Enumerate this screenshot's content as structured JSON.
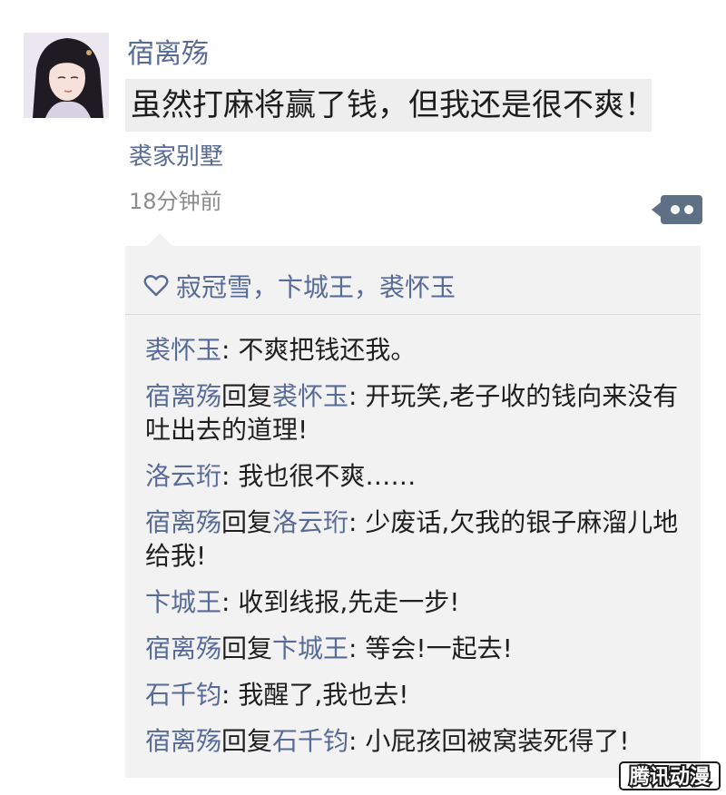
{
  "post": {
    "author": "宿离殇",
    "text": "虽然打麻将赢了钱，但我还是很不爽！",
    "location": "裘家别墅",
    "time": "18分钟前"
  },
  "likes": {
    "names": "寂冠雪，卞城王，裘怀玉"
  },
  "comments": [
    {
      "from": "裘怀玉",
      "reply_word": "",
      "to": "",
      "text": ": 不爽把钱还我。"
    },
    {
      "from": "宿离殇",
      "reply_word": "回复",
      "to": "裘怀玉",
      "text": ": 开玩笑,老子收的钱向来没有吐出去的道理!"
    },
    {
      "from": "洛云珩",
      "reply_word": "",
      "to": "",
      "text": ": 我也很不爽……"
    },
    {
      "from": "宿离殇",
      "reply_word": "回复",
      "to": "洛云珩",
      "text": ": 少废话,欠我的银子麻溜儿地给我!"
    },
    {
      "from": "卞城王",
      "reply_word": "",
      "to": "",
      "text": ": 收到线报,先走一步!"
    },
    {
      "from": "宿离殇",
      "reply_word": "回复",
      "to": "卞城王",
      "text": ": 等会!一起去!"
    },
    {
      "from": "石千钧",
      "reply_word": "",
      "to": "",
      "text": ": 我醒了,我也去!"
    },
    {
      "from": "宿离殇",
      "reply_word": "回复",
      "to": "石千钧",
      "text": ": 小屁孩回被窝装死得了!"
    }
  ],
  "watermark": "腾讯动漫",
  "icons": {
    "avatar": "avatar-image",
    "more": "comment-more-icon",
    "like": "heart-icon"
  },
  "colors": {
    "name_link": "#586b96",
    "text": "#222222",
    "secondary": "#8c8c8c",
    "comment_bg": "#f2f2f2",
    "highlight_bg": "#eeeeee",
    "button_bg": "#5f6f86"
  }
}
